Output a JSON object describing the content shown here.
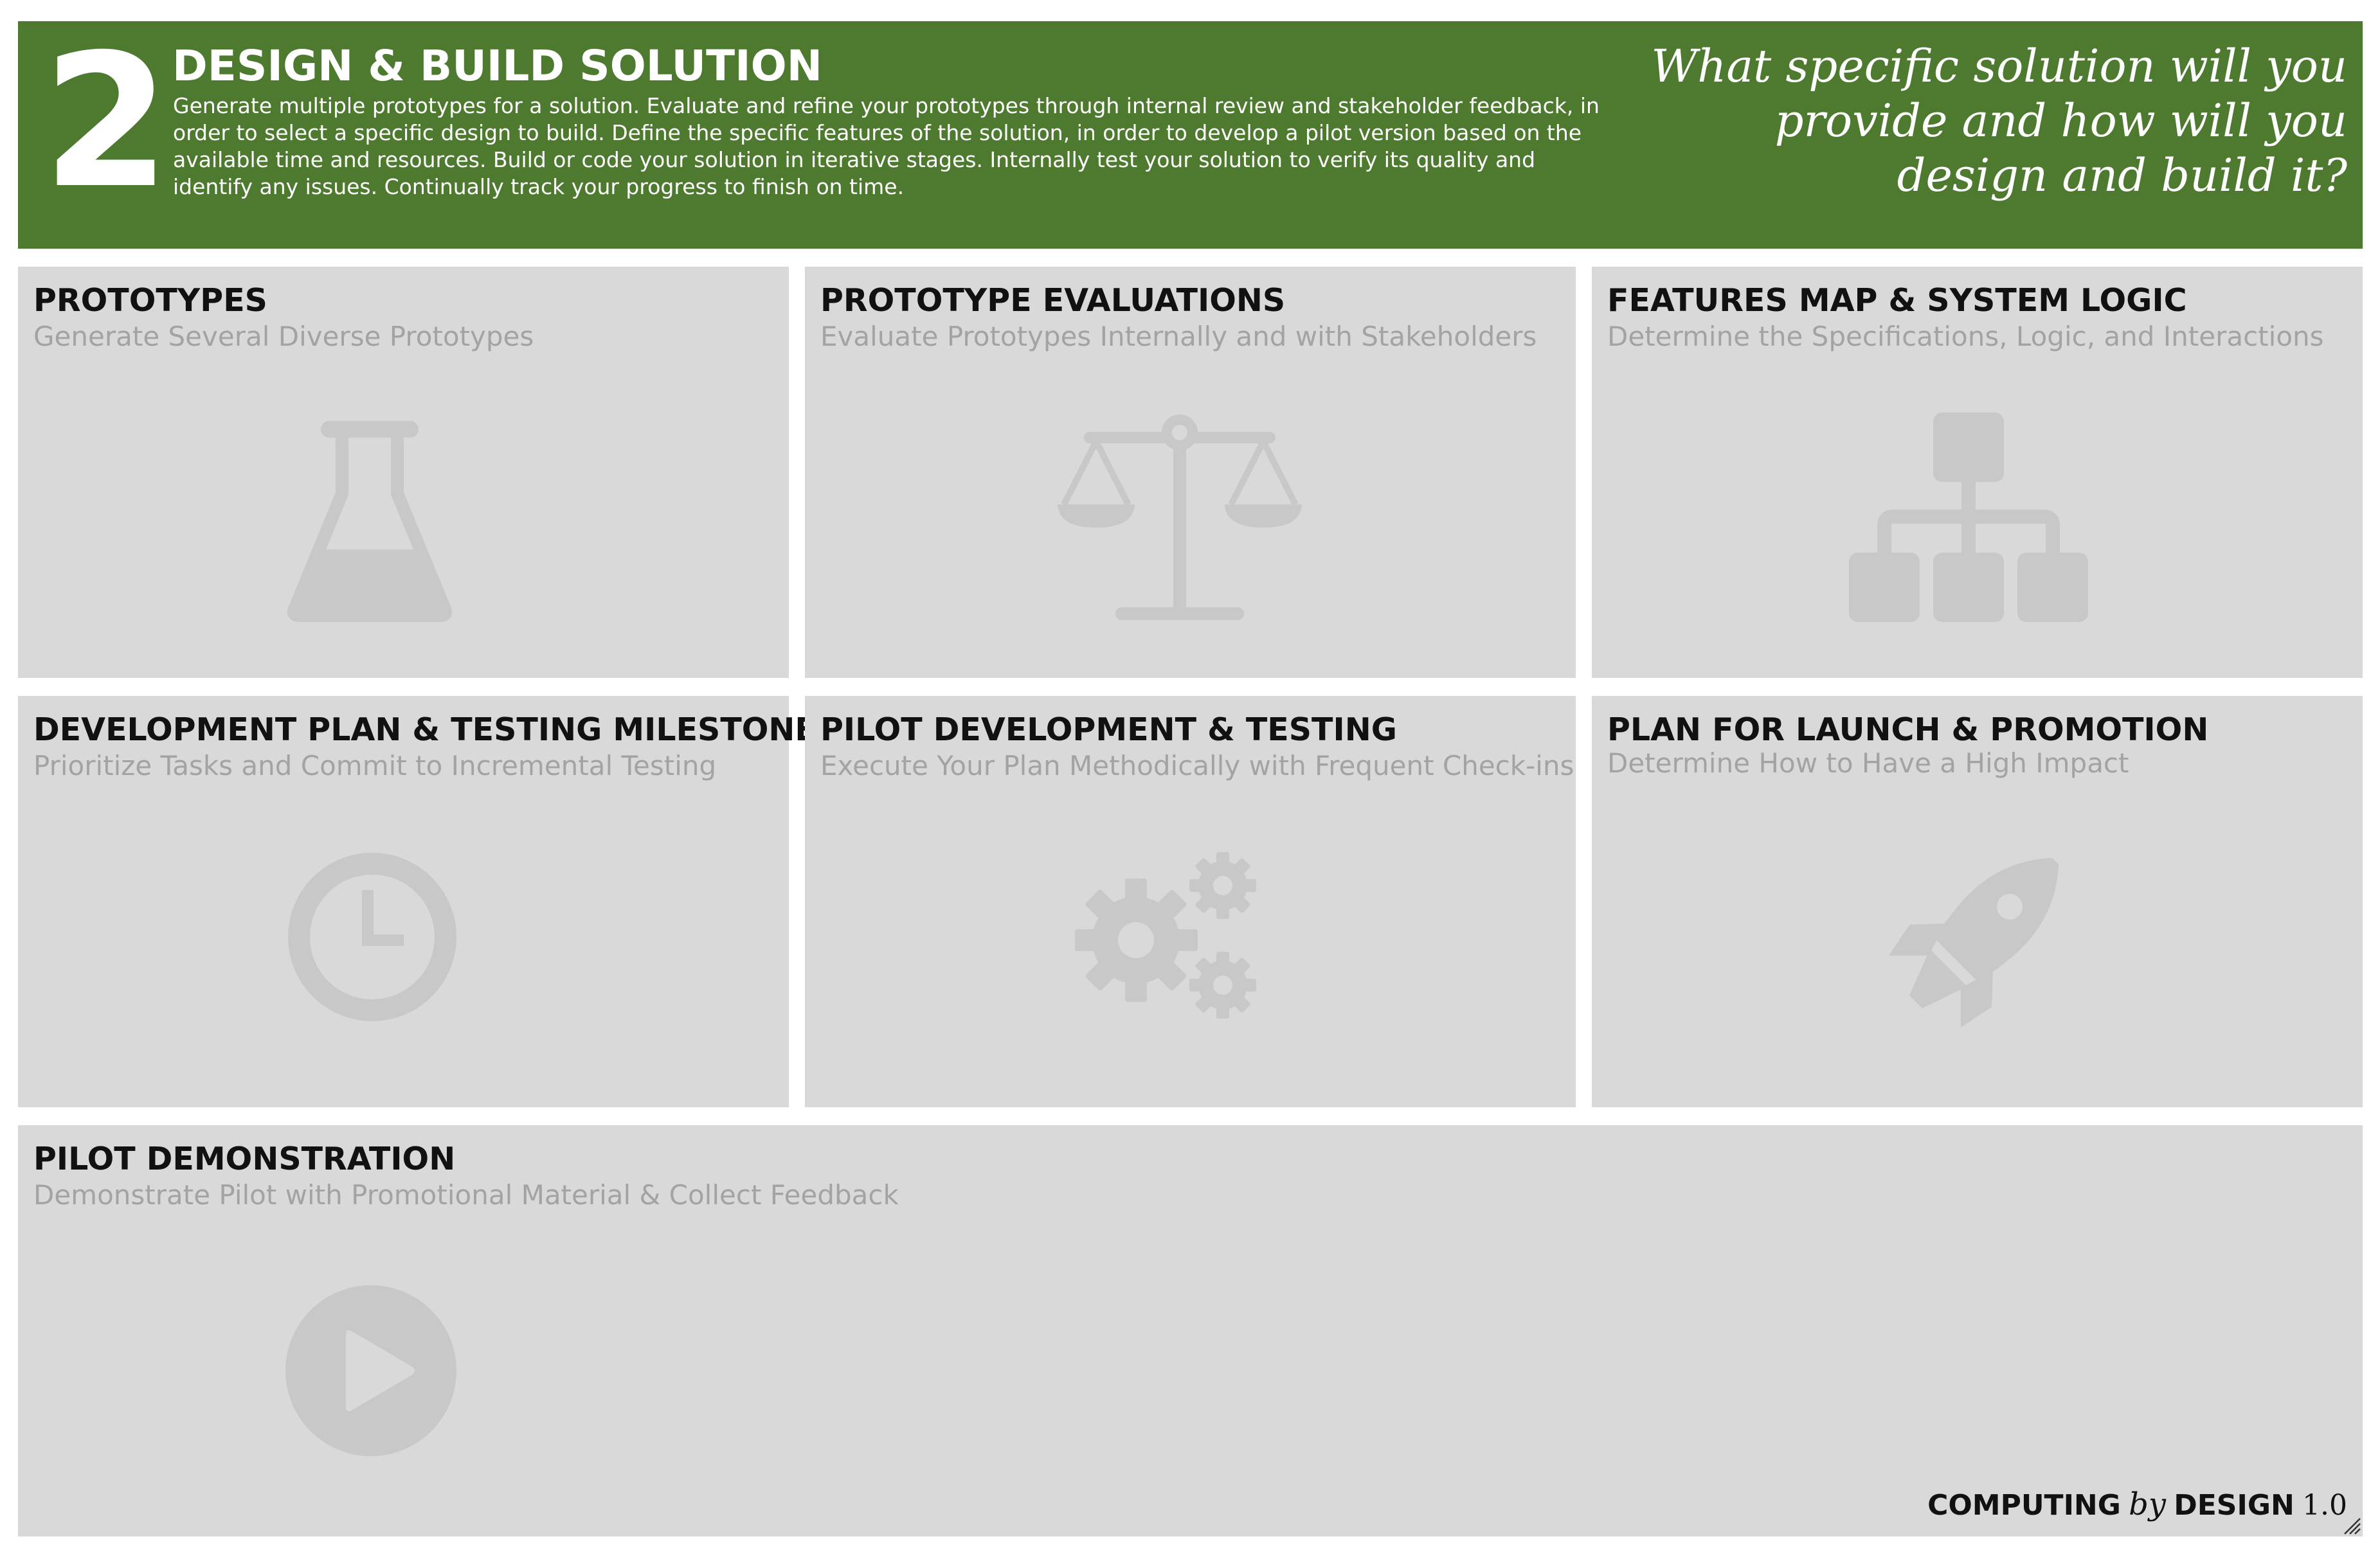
{
  "header": {
    "number": "2",
    "title": "DESIGN & BUILD SOLUTION",
    "description": "Generate multiple prototypes for a solution. Evaluate and refine your prototypes through internal review and stakeholder feedback, in order to select a specific design to build. Define the specific features of the solution, in order to develop a pilot version based on the available time and resources. Build or code your solution in iterative stages.  Internally test your solution to verify its quality and identify any issues. Continually track your progress to finish on time.",
    "question": "What specific solution will you provide and how will you design and build it?"
  },
  "cards": [
    {
      "title": "PROTOTYPES",
      "subtitle": "Generate Several Diverse Prototypes",
      "icon": "flask-icon"
    },
    {
      "title": "PROTOTYPE EVALUATIONS",
      "subtitle": "Evaluate Prototypes Internally and with Stakeholders",
      "icon": "balance-scale-icon"
    },
    {
      "title": "FEATURES MAP & SYSTEM LOGIC",
      "subtitle": "Determine the Specifications, Logic, and Interactions",
      "icon": "sitemap-icon"
    },
    {
      "title": "DEVELOPMENT PLAN & TESTING MILESTONES",
      "subtitle": "Prioritize Tasks and Commit to Incremental Testing",
      "icon": "clock-icon"
    },
    {
      "title": "PILOT DEVELOPMENT & TESTING",
      "subtitle": "Execute Your Plan Methodically with Frequent Check-ins",
      "icon": "gears-icon"
    },
    {
      "title": "PLAN FOR LAUNCH & PROMOTION",
      "subtitle": "Determine How to Have a High Impact",
      "icon": "rocket-icon"
    },
    {
      "title": "PILOT DEMONSTRATION",
      "subtitle": "Demonstrate Pilot with Promotional Material & Collect Feedback",
      "icon": "play-icon"
    }
  ],
  "footer": {
    "brand_word1": "COMPUTING",
    "brand_by": "by",
    "brand_word2": "DESIGN",
    "version": "1.0"
  },
  "colors": {
    "header_bg": "#4d7a2f",
    "card_bg": "#d9d9d9",
    "icon": "#c8c8c8",
    "subtitle": "#a3a3a3"
  }
}
